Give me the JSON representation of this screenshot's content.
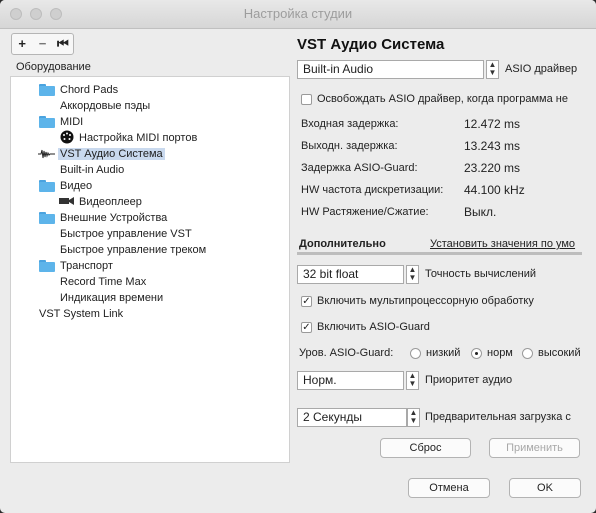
{
  "window": {
    "title": "Настройка студии"
  },
  "toolbar": {
    "add": "+",
    "remove": "−",
    "reset": "⏮"
  },
  "hardware_label": "Оборудование",
  "tree": {
    "chord_pads": "Chord Pads",
    "chord_pads_child": "Аккордовые пэды",
    "midi": "MIDI",
    "midi_child": "Настройка MIDI портов",
    "vst_audio": "VST Аудио Система",
    "vst_audio_child": "Built-in Audio",
    "video": "Видео",
    "video_child": "Видеоплеер",
    "remote": "Внешние Устройства",
    "remote_child1": "Быстрое управление VST",
    "remote_child2": "Быстрое управление треком",
    "transport": "Транспорт",
    "transport_child1": "Record Time Max",
    "transport_child2": "Индикация времени",
    "system_link": "VST System Link"
  },
  "panel": {
    "title": "VST Аудио Система",
    "driver_value": "Built-in Audio",
    "driver_label": "ASIO драйвер",
    "release_driver": "Освобождать ASIO драйвер, когда программа не",
    "input_latency_label": "Входная задержка:",
    "input_latency_value": "12.472 ms",
    "output_latency_label": "Выходн. задержка:",
    "output_latency_value": "13.243 ms",
    "asio_guard_latency_label": "Задержка ASIO-Guard:",
    "asio_guard_latency_value": "23.220 ms",
    "hw_rate_label": "HW частота дискретизации:",
    "hw_rate_value": "44.100 kHz",
    "hw_pull_label": "HW Растяжение/Сжатие:",
    "hw_pull_value": "Выкл.",
    "tab_advanced": "Дополнительно",
    "tab_defaults": "Установить значения по умо",
    "precision_value": "32 bit float",
    "precision_label": "Точность вычислений",
    "multiprocessing": "Включить мультипроцессорную обработку",
    "asio_guard_enable": "Включить ASIO-Guard",
    "asio_guard_level_label": "Уров. ASIO-Guard:",
    "level_low": "низкий",
    "level_normal": "норм",
    "level_high": "высокий",
    "priority_value": "Норм.",
    "priority_label": "Приоритет аудио",
    "preload_value": "2 Секунды",
    "preload_label": "Предварительная загрузка с",
    "reset_button": "Сброс",
    "apply_button": "Применить"
  },
  "footer": {
    "cancel": "Отмена",
    "ok": "OK"
  }
}
